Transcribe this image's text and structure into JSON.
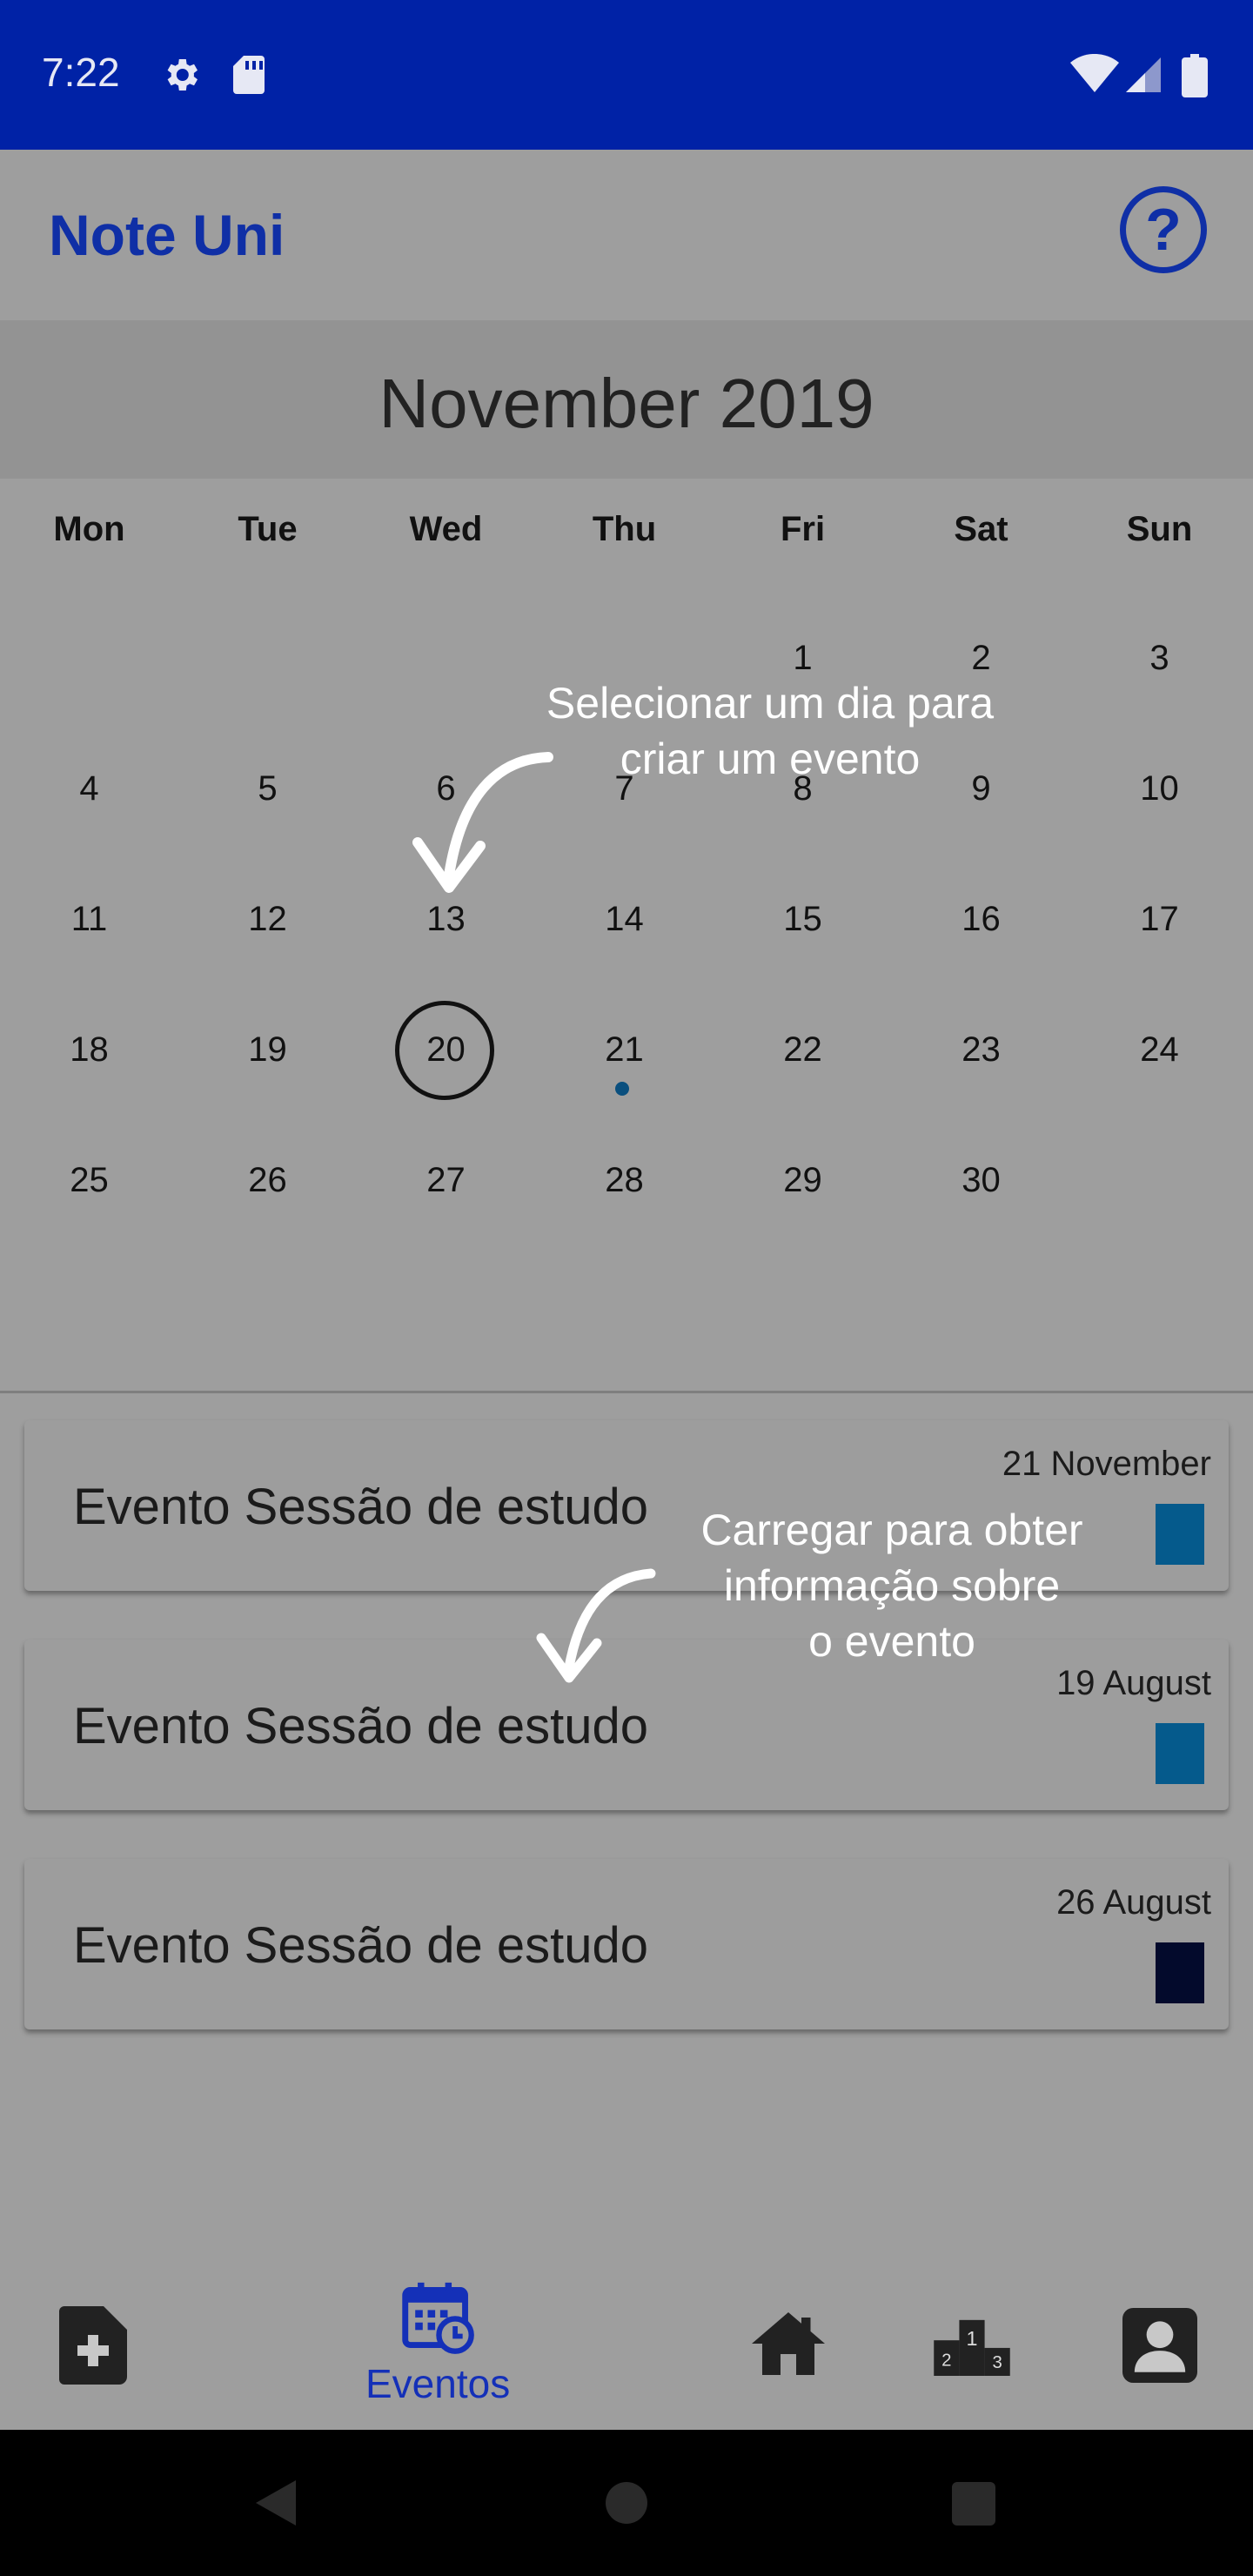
{
  "status_bar": {
    "time": "7:22",
    "icons": [
      "settings-icon",
      "sd-card-icon",
      "wifi-icon",
      "signal-icon",
      "battery-icon"
    ]
  },
  "app_bar": {
    "title": "Note Uni",
    "help_icon": "help-icon",
    "help_glyph": "?"
  },
  "calendar": {
    "month": "November 2019",
    "weekdays": [
      "Mon",
      "Tue",
      "Wed",
      "Thu",
      "Fri",
      "Sat",
      "Sun"
    ],
    "weeks": [
      [
        "",
        "",
        "",
        "",
        "1",
        "2",
        "3"
      ],
      [
        "4",
        "5",
        "6",
        "7",
        "8",
        "9",
        "10"
      ],
      [
        "11",
        "12",
        "13",
        "14",
        "15",
        "16",
        "17"
      ],
      [
        "18",
        "19",
        "20",
        "21",
        "22",
        "23",
        "24"
      ],
      [
        "25",
        "26",
        "27",
        "28",
        "29",
        "30",
        ""
      ]
    ],
    "selected_day": "20",
    "days_with_events": [
      "21"
    ]
  },
  "tips": {
    "select_day": "Selecionar um dia para criar um evento",
    "select_day_lines": [
      "Selecionar um dia para",
      "criar um evento"
    ],
    "tap_event": "Carregar para obter informação sobre o evento",
    "tap_event_lines": [
      "Carregar para obter",
      "informação sobre",
      "o evento"
    ]
  },
  "events": [
    {
      "title": "Evento Sessão de estudo",
      "date": "21 November",
      "color": "#055a8c"
    },
    {
      "title": "Evento Sessão de estudo",
      "date": "19 August",
      "color": "#055a8c"
    },
    {
      "title": "Evento Sessão de estudo",
      "date": "26 August",
      "color": "#030a2c"
    }
  ],
  "bottom_nav": {
    "items": [
      {
        "icon": "add-note-icon",
        "label": ""
      },
      {
        "icon": "events-calendar-icon",
        "label": "Eventos",
        "active": true
      },
      {
        "icon": "home-icon",
        "label": ""
      },
      {
        "icon": "ranking-podium-icon",
        "label": ""
      },
      {
        "icon": "profile-icon",
        "label": ""
      }
    ]
  },
  "colors": {
    "accent": "#0f2fa6",
    "status_bar": "#0022a6",
    "background": "#9e9e9e"
  }
}
